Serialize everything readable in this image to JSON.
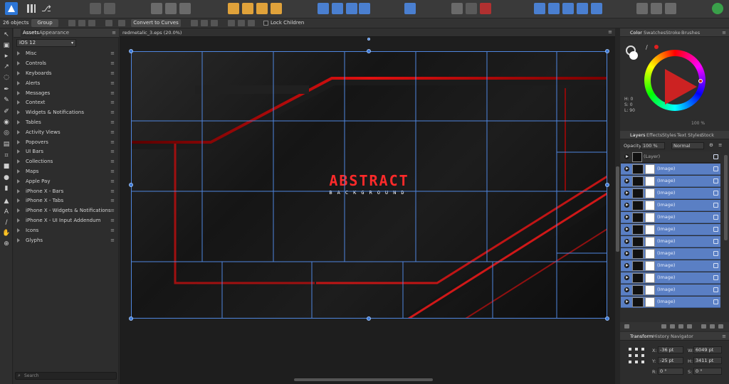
{
  "toolbar": {
    "status": "26 objects",
    "group_label": "Group",
    "convert_label": "Convert to Curves",
    "lock_children_label": "Lock Children"
  },
  "assets_panel": {
    "tabs": [
      "Assets",
      "Appearance"
    ],
    "category": "iOS 12",
    "items": [
      "Misc",
      "Controls",
      "Keyboards",
      "Alerts",
      "Messages",
      "Context",
      "Widgets & Notifications",
      "Tables",
      "Activity Views",
      "Popovers",
      "UI Bars",
      "Collections",
      "Maps",
      "Apple Pay",
      "iPhone X - Bars",
      "iPhone X - Tabs",
      "iPhone X - Widgets & Notifications",
      "iPhone X - UI Input Addendum",
      "Icons",
      "Glyphs"
    ],
    "search_placeholder": "Search"
  },
  "document": {
    "tab_title": "redmetalic_3.eps (20.0%)"
  },
  "artwork": {
    "title": "ABSTRACT",
    "subtitle": "BACKGROUND",
    "accent_color": "#ff2a2a"
  },
  "color_panel": {
    "tabs": [
      "Color",
      "Swatches",
      "Stroke",
      "Brushes"
    ],
    "h": "H: 0",
    "s": "S: 0",
    "l": "L: 90",
    "opacity": "100 %"
  },
  "layers_panel": {
    "tabs": [
      "Layers",
      "Effects",
      "Styles",
      "Text Styles",
      "Stock"
    ],
    "opacity_label": "Opacity:",
    "opacity_value": "100 %",
    "blend_mode": "Normal",
    "parent_layer": "(Layer)",
    "layers": [
      "(Image)",
      "(Image)",
      "(Image)",
      "(Image)",
      "(Image)",
      "(Image)",
      "(Image)",
      "(Image)",
      "(Image)",
      "(Image)",
      "(Image)",
      "(Image)"
    ]
  },
  "transform_panel": {
    "tabs": [
      "Transform",
      "History",
      "Navigator"
    ],
    "x_label": "X:",
    "x_value": "-36 pt",
    "y_label": "Y:",
    "y_value": "-25 pt",
    "w_label": "W:",
    "w_value": "6049 pt",
    "h_label": "H:",
    "h_value": "3411 pt",
    "r_label": "R:",
    "r_value": "0 °",
    "s_label": "S:",
    "s_value": "0 °"
  }
}
